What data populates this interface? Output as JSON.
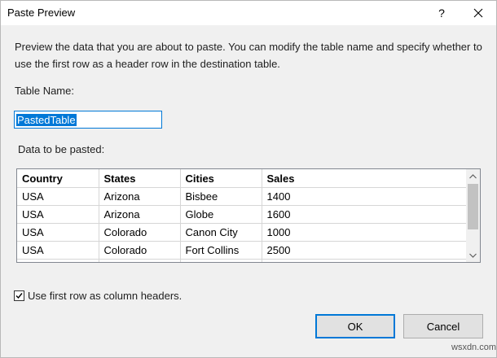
{
  "dialog": {
    "title": "Paste Preview",
    "help_label": "?",
    "description": "Preview the data that you are about to paste. You can modify the table name and specify whether to use the first row as a header row in the destination table.",
    "table_name_label": "Table Name:",
    "table_name_value": "PastedTable",
    "data_label": "Data to be pasted:",
    "checkbox_label": "Use first row as column headers.",
    "checkbox_checked": true,
    "ok_label": "OK",
    "cancel_label": "Cancel"
  },
  "table": {
    "headers": [
      "Country",
      "States",
      "Cities",
      "Sales"
    ],
    "rows": [
      [
        "USA",
        "Arizona",
        "Bisbee",
        "1400"
      ],
      [
        "USA",
        "Arizona",
        "Globe",
        "1600"
      ],
      [
        "USA",
        "Colorado",
        "Canon City",
        "1000"
      ],
      [
        "USA",
        "Colorado",
        "Fort Collins",
        "2500"
      ]
    ]
  },
  "watermark": "wsxdn.com",
  "colors": {
    "accent": "#0078d7",
    "background": "#f0f0f0"
  },
  "icons": {
    "close": "close-icon",
    "scroll_up": "chevron-up-icon",
    "scroll_down": "chevron-down-icon",
    "check": "check-icon"
  }
}
